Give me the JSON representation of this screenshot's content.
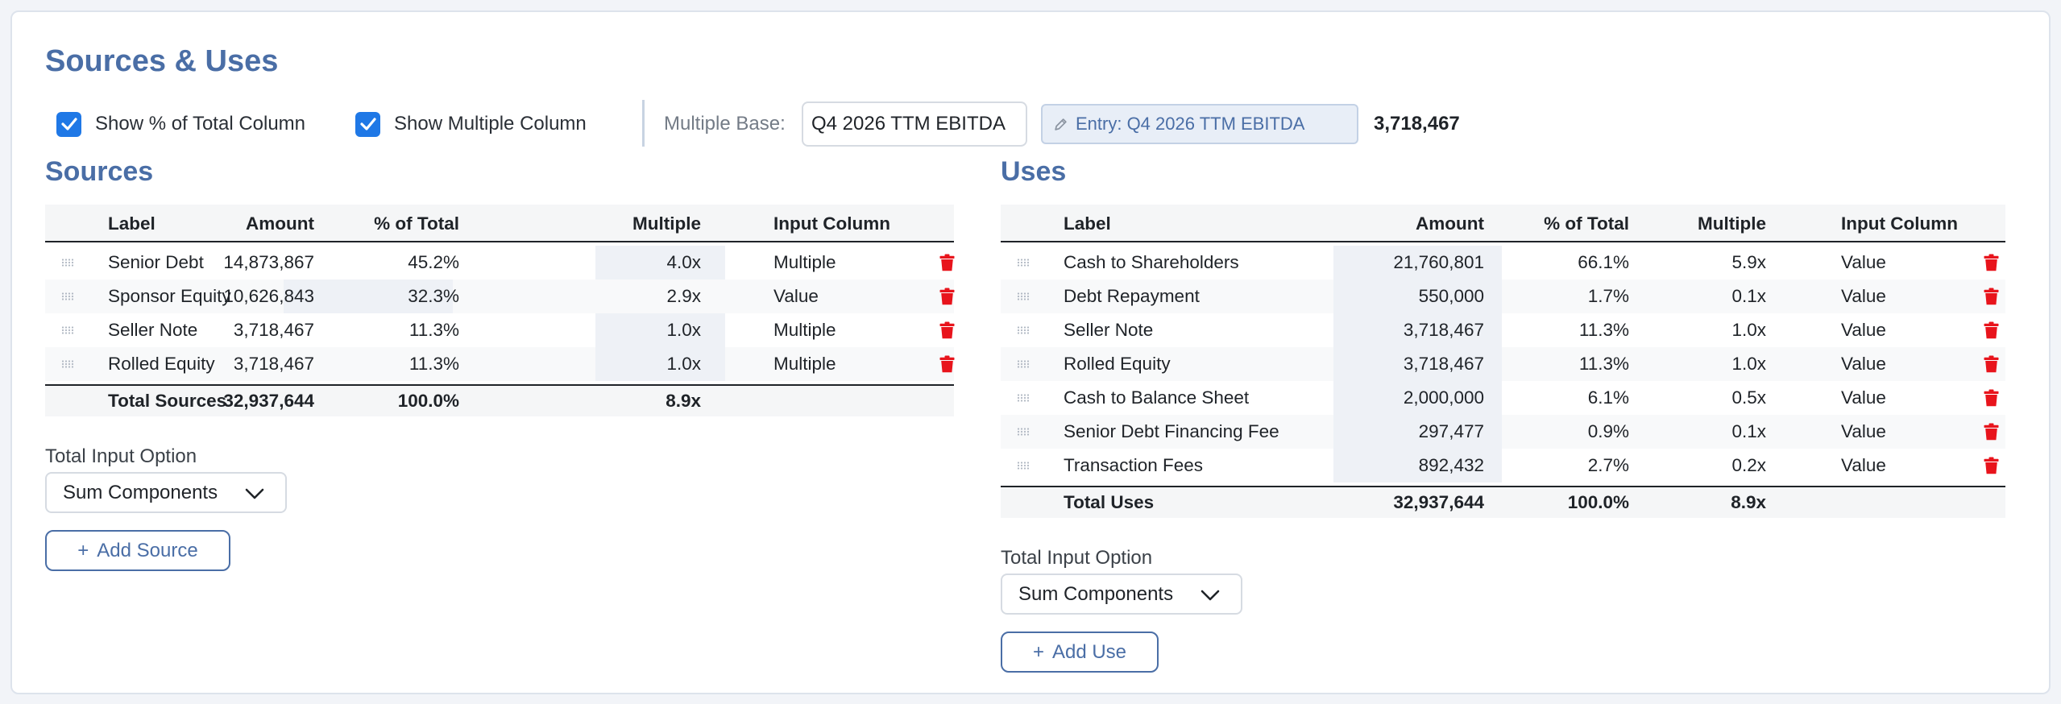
{
  "page": {
    "title": "Sources & Uses"
  },
  "toolbar": {
    "show_pct_label": "Show % of Total Column",
    "show_multiple_label": "Show Multiple Column",
    "multiple_base_label": "Multiple Base:",
    "multiple_base_value": "Q4 2026 TTM EBITDA",
    "entry_badge": "Entry: Q4 2026 TTM EBITDA",
    "multiple_base_amount": "3,718,467"
  },
  "columns": {
    "label": "Label",
    "amount": "Amount",
    "pct": "% of Total",
    "multiple": "Multiple",
    "input_column": "Input Column"
  },
  "sources": {
    "title": "Sources",
    "rows": [
      {
        "label": "Senior Debt",
        "amount": "14,873,867",
        "pct": "45.2%",
        "multiple": "4.0x",
        "input_column": "Multiple"
      },
      {
        "label": "Sponsor Equity",
        "amount": "10,626,843",
        "pct": "32.3%",
        "multiple": "2.9x",
        "input_column": "Value"
      },
      {
        "label": "Seller Note",
        "amount": "3,718,467",
        "pct": "11.3%",
        "multiple": "1.0x",
        "input_column": "Multiple"
      },
      {
        "label": "Rolled Equity",
        "amount": "3,718,467",
        "pct": "11.3%",
        "multiple": "1.0x",
        "input_column": "Multiple"
      }
    ],
    "total": {
      "label": "Total Sources",
      "amount": "32,937,644",
      "pct": "100.0%",
      "multiple": "8.9x"
    },
    "total_input_label": "Total Input Option",
    "total_input_value": "Sum Components",
    "add_label": "Add Source"
  },
  "uses": {
    "title": "Uses",
    "rows": [
      {
        "label": "Cash to Shareholders",
        "amount": "21,760,801",
        "pct": "66.1%",
        "multiple": "5.9x",
        "input_column": "Value"
      },
      {
        "label": "Debt Repayment",
        "amount": "550,000",
        "pct": "1.7%",
        "multiple": "0.1x",
        "input_column": "Value"
      },
      {
        "label": "Seller Note",
        "amount": "3,718,467",
        "pct": "11.3%",
        "multiple": "1.0x",
        "input_column": "Value"
      },
      {
        "label": "Rolled Equity",
        "amount": "3,718,467",
        "pct": "11.3%",
        "multiple": "1.0x",
        "input_column": "Value"
      },
      {
        "label": "Cash to Balance Sheet",
        "amount": "2,000,000",
        "pct": "6.1%",
        "multiple": "0.5x",
        "input_column": "Value"
      },
      {
        "label": "Senior Debt Financing Fee",
        "amount": "297,477",
        "pct": "0.9%",
        "multiple": "0.1x",
        "input_column": "Value"
      },
      {
        "label": "Transaction Fees",
        "amount": "892,432",
        "pct": "2.7%",
        "multiple": "0.2x",
        "input_column": "Value"
      }
    ],
    "total": {
      "label": "Total Uses",
      "amount": "32,937,644",
      "pct": "100.0%",
      "multiple": "8.9x"
    },
    "total_input_label": "Total Input Option",
    "total_input_value": "Sum Components",
    "add_label": "Add Use"
  },
  "icons": {
    "check": "checkmark-icon",
    "pencil": "pencil-icon",
    "grip": "drag-handle-icon",
    "trash": "trash-icon",
    "chevron": "chevron-down-icon",
    "plus": "plus-icon"
  },
  "colors": {
    "accent": "#4a6ea6",
    "checkbox": "#1f78e6",
    "delete": "#e8141c"
  }
}
